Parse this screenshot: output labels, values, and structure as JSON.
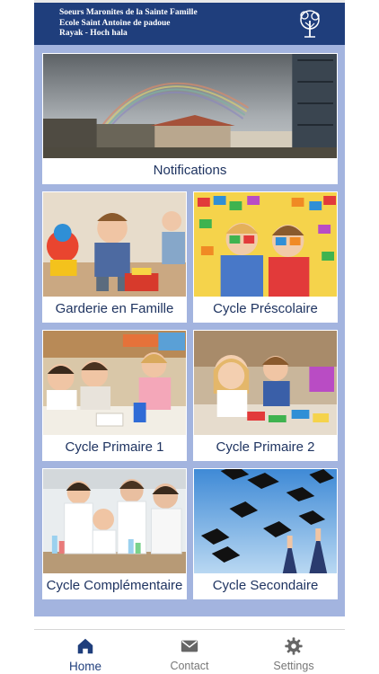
{
  "header": {
    "line1": "Soeurs Maronites de la Sainte Famille",
    "line2": "Ecole Saint Antoine de padoue",
    "line3": "Rayak - Hoch hala",
    "logo_icon": "school-logo-icon",
    "background": "#1f3e7c"
  },
  "tiles": [
    {
      "label": "Notifications",
      "image": "rainbow-campus-photo"
    },
    {
      "label": "Garderie en Famille",
      "image": "toddlers-playing-photo"
    },
    {
      "label": "Cycle Préscolaire",
      "image": "children-with-blocks-photo"
    },
    {
      "label": "Cycle Primaire 1",
      "image": "children-drawing-photo"
    },
    {
      "label": "Cycle Primaire 2",
      "image": "girls-crafting-photo"
    },
    {
      "label": "Cycle Complémentaire",
      "image": "science-lab-photo"
    },
    {
      "label": "Cycle Secondaire",
      "image": "graduation-caps-photo"
    }
  ],
  "nav": {
    "items": [
      {
        "label": "Home",
        "icon": "home-icon",
        "active": true
      },
      {
        "label": "Contact",
        "icon": "envelope-icon",
        "active": false
      },
      {
        "label": "Settings",
        "icon": "gear-icon",
        "active": false
      }
    ]
  },
  "colors": {
    "accent": "#1f3e7c",
    "grid_background": "#a3b4df",
    "label_text": "#1f3461"
  }
}
